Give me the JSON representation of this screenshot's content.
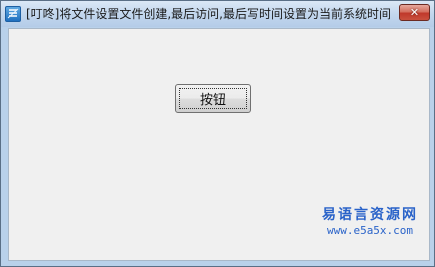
{
  "window": {
    "title": "[叮咚]将文件设置文件创建,最后访问,最后写时间设置为当前系统时间",
    "close_glyph": "✕",
    "app_icon": "app-icon",
    "colors": {
      "title_bar": "#c3d7ee",
      "client_bg": "#f0f0f0",
      "close_button": "#c9503d"
    }
  },
  "main": {
    "button_label": "按钮"
  },
  "watermark": {
    "title": "易语言资源网",
    "url": "www.e5a5x.com",
    "color": "#2a63c9"
  }
}
